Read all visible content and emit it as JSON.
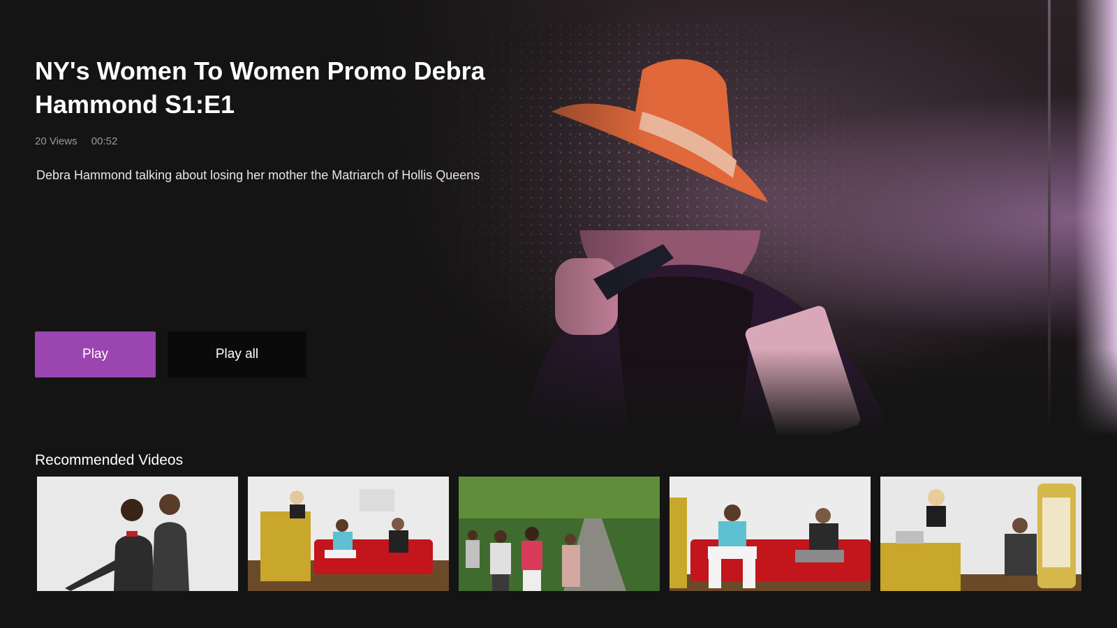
{
  "video": {
    "title": "NY's Women To Women Promo Debra Hammond S1:E1",
    "views": "20 Views",
    "duration": "00:52",
    "description": "Debra Hammond talking about losing her mother the Matriarch of Hollis Queens"
  },
  "actions": {
    "play_label": "Play",
    "play_all_label": "Play all"
  },
  "recommended": {
    "heading": "Recommended Videos",
    "items": [
      {
        "thumb": "two-women-studio"
      },
      {
        "thumb": "panel-red-couch-gold-table"
      },
      {
        "thumb": "group-walking-garden"
      },
      {
        "thumb": "two-men-red-couch"
      },
      {
        "thumb": "host-gold-table-throne"
      }
    ]
  },
  "colors": {
    "background": "#141414",
    "accent": "#9a45b0",
    "secondary_button": "#0a0a0a",
    "meta_text": "#9a9a9a"
  }
}
